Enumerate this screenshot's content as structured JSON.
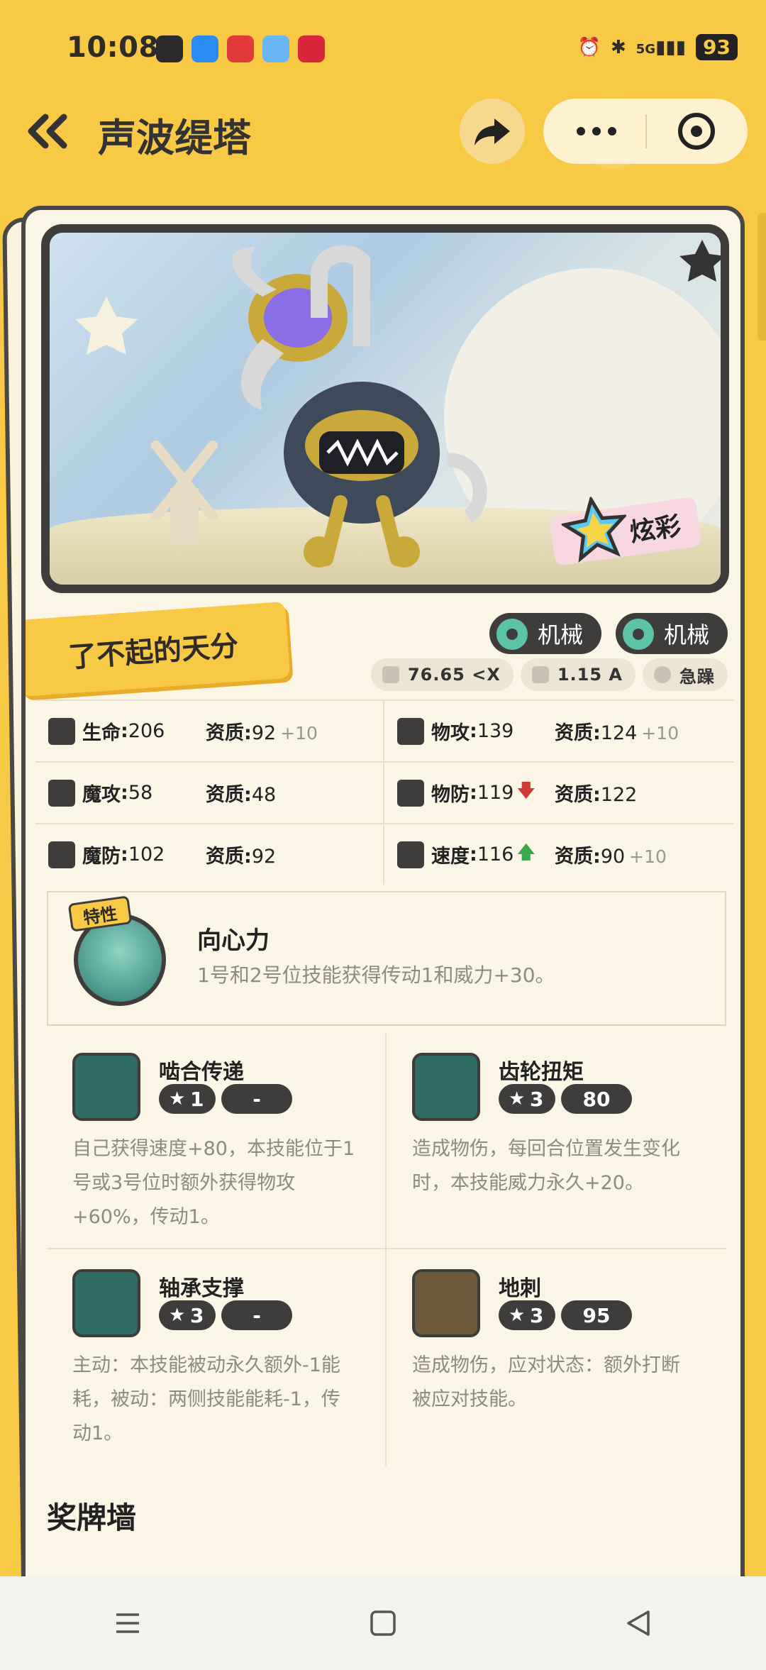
{
  "status_bar": {
    "time": "10:08",
    "network": "5G",
    "battery": "93"
  },
  "header": {
    "title": "声波缇塔"
  },
  "hero": {
    "flair_label": "炫彩"
  },
  "talent": "了不起的天分",
  "types": [
    "机械",
    "机械"
  ],
  "metrics": {
    "weight": "76.65 <X",
    "height": "1.15 A",
    "nature": "急躁"
  },
  "stats": [
    {
      "left": {
        "name": "生命",
        "value": "206",
        "apt_label": "资质",
        "apt": "92",
        "bonus": "+10",
        "arrow": ""
      },
      "right": {
        "name": "物攻",
        "value": "139",
        "apt_label": "资质",
        "apt": "124",
        "bonus": "+10",
        "arrow": ""
      }
    },
    {
      "left": {
        "name": "魔攻",
        "value": "58",
        "apt_label": "资质",
        "apt": "48",
        "bonus": "",
        "arrow": ""
      },
      "right": {
        "name": "物防",
        "value": "119",
        "apt_label": "资质",
        "apt": "122",
        "bonus": "",
        "arrow": "down"
      }
    },
    {
      "left": {
        "name": "魔防",
        "value": "102",
        "apt_label": "资质",
        "apt": "92",
        "bonus": "",
        "arrow": ""
      },
      "right": {
        "name": "速度",
        "value": "116",
        "apt_label": "资质",
        "apt": "90",
        "bonus": "+10",
        "arrow": "up"
      }
    }
  ],
  "trait": {
    "tag": "特性",
    "name": "向心力",
    "desc": "1号和2号位技能获得传动1和威力+30。"
  },
  "skills": [
    {
      "name": "啮合传递",
      "cost": "1",
      "power": "-",
      "desc": "自己获得速度+80，本技能位于1号或3号位时额外获得物攻+60%，传动1。"
    },
    {
      "name": "齿轮扭矩",
      "cost": "3",
      "power": "80",
      "desc": "造成物伤，每回合位置发生变化时，本技能威力永久+20。"
    },
    {
      "name": "轴承支撑",
      "cost": "3",
      "power": "-",
      "desc": "主动：本技能被动永久额外-1能耗，被动：两侧技能能耗-1，传动1。"
    },
    {
      "name": "地刺",
      "cost": "3",
      "power": "95",
      "desc": "造成物伤，应对状态：额外打断被应对技能。"
    }
  ],
  "medal_wall": "奖牌墙",
  "colors": {
    "bg": "#f8c945",
    "card": "#fbf5e6",
    "dark": "#3f3d3b",
    "teal": "#5cc3a6",
    "up": "#3aa84d",
    "down": "#d23a3a"
  }
}
